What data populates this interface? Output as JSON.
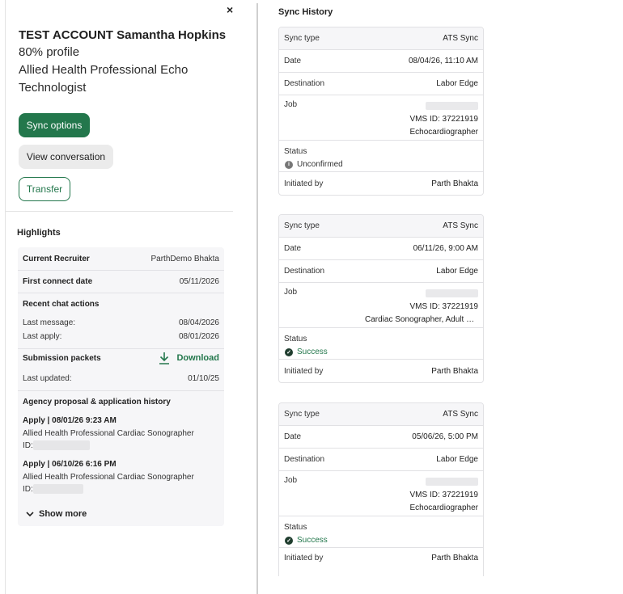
{
  "profile": {
    "name": "TEST ACCOUNT Samantha Hopkins",
    "completion": "80% profile",
    "role_line1": "Allied Health Professional Echo",
    "role_line2": "Technologist"
  },
  "actions": {
    "sync_options": "Sync options",
    "view_conversation": "View conversation",
    "transfer": "Transfer"
  },
  "icons": {
    "close": "×",
    "download": "download-icon",
    "chevron": "chevron-down-icon",
    "info": "info-icon",
    "check": "check-circle-icon"
  },
  "highlights": {
    "title": "Highlights",
    "current_recruiter_label": "Current Recruiter",
    "current_recruiter_value": "ParthDemo Bhakta",
    "first_connect_label": "First connect date",
    "first_connect_value": "05/11/2026",
    "recent_chat_title": "Recent chat actions",
    "last_message_label": "Last message:",
    "last_message_value": "08/04/2026",
    "last_apply_label": "Last apply:",
    "last_apply_value": "08/01/2026",
    "submission_title": "Submission packets",
    "download_label": "Download",
    "last_updated_label": "Last updated:",
    "last_updated_value": "01/10/25",
    "history_title": "Agency proposal & application history",
    "history": [
      {
        "title": "Apply | 08/01/26 9:23 AM",
        "desc": "Allied Health Professional Cardiac Sonographer",
        "id_label": "ID:"
      },
      {
        "title": "Apply | 06/10/26 6:16 PM",
        "desc": "Allied Health Professional Cardiac Sonographer",
        "id_label": "ID:"
      }
    ],
    "show_more": "Show more"
  },
  "sync_history": {
    "title": "Sync History",
    "labels": {
      "sync_type": "Sync type",
      "date": "Date",
      "destination": "Destination",
      "job": "Job",
      "status": "Status",
      "initiated_by": "Initiated by"
    },
    "entries": [
      {
        "sync_type": "ATS Sync",
        "date": "08/04/26, 11:10 AM",
        "destination": "Labor Edge",
        "vms": "VMS ID: 37221919",
        "job_title": "Echocardiographer",
        "status": "Unconfirmed",
        "initiated_by": "Parth Bhakta"
      },
      {
        "sync_type": "ATS Sync",
        "date": "06/11/26, 9:00 AM",
        "destination": "Labor Edge",
        "vms": "VMS ID: 37221919",
        "job_title": "Cardiac Sonographer, Adult Echocardiography",
        "status": "Success",
        "initiated_by": "Parth Bhakta"
      },
      {
        "sync_type": "ATS Sync",
        "date": "05/06/26, 5:00 PM",
        "destination": "Labor Edge",
        "vms": "VMS ID: 37221919",
        "job_title": "Echocardiographer",
        "status": "Success",
        "initiated_by": "Parth Bhakta"
      }
    ]
  },
  "colors": {
    "primary_green": "#23774c",
    "success_green": "#23774c",
    "panel_gray": "#f6f6f8"
  }
}
